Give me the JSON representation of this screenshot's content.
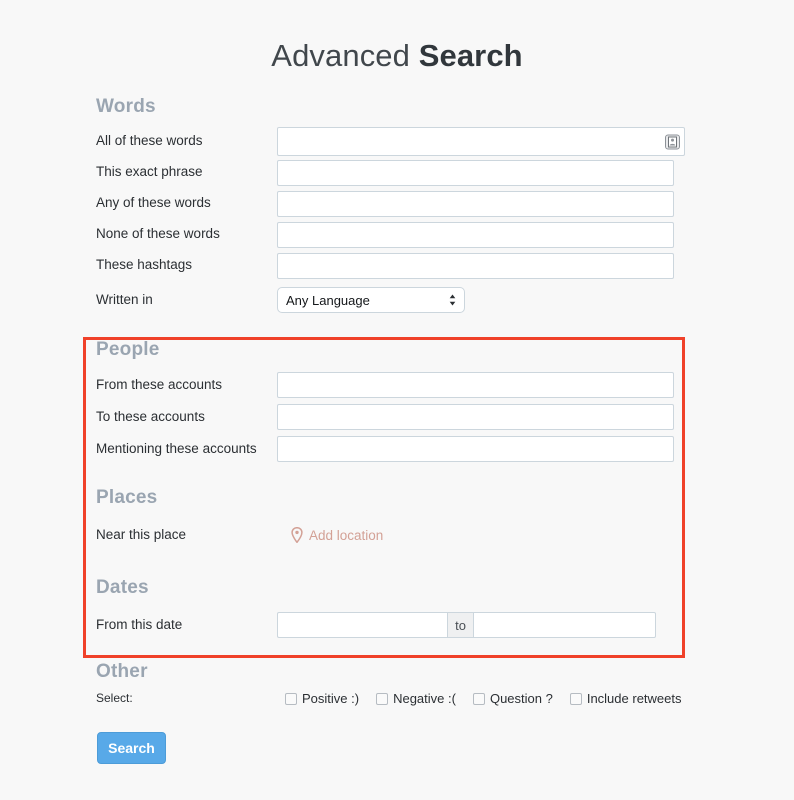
{
  "header": {
    "title_light": "Advanced ",
    "title_bold": "Search"
  },
  "sections": {
    "words": {
      "heading": "Words",
      "fields": [
        {
          "label": "All of these words",
          "value": "",
          "placeholder": "",
          "icon": "contact-card-icon"
        },
        {
          "label": "This exact phrase",
          "value": "",
          "placeholder": ""
        },
        {
          "label": "Any of these words",
          "value": "",
          "placeholder": ""
        },
        {
          "label": "None of these words",
          "value": "",
          "placeholder": ""
        },
        {
          "label": "These hashtags",
          "value": "",
          "placeholder": ""
        }
      ],
      "language": {
        "label": "Written in",
        "selected": "Any Language"
      }
    },
    "people": {
      "heading": "People",
      "fields": [
        {
          "label": "From these accounts",
          "value": "",
          "placeholder": ""
        },
        {
          "label": "To these accounts",
          "value": "",
          "placeholder": ""
        },
        {
          "label": "Mentioning these accounts",
          "value": "",
          "placeholder": ""
        }
      ]
    },
    "places": {
      "heading": "Places",
      "label": "Near this place",
      "link_text": "Add location",
      "link_icon": "map-pin-icon"
    },
    "dates": {
      "heading": "Dates",
      "label": "From this date",
      "from_value": "",
      "from_placeholder": "",
      "separator": "to",
      "to_value": "",
      "to_placeholder": ""
    },
    "other": {
      "heading": "Other",
      "select_label": "Select:",
      "checkboxes": [
        {
          "label": "Positive :)",
          "checked": false
        },
        {
          "label": "Negative :(",
          "checked": false
        },
        {
          "label": "Question ?",
          "checked": false
        },
        {
          "label": "Include retweets",
          "checked": false
        }
      ]
    }
  },
  "submit": {
    "label": "Search"
  },
  "colors": {
    "page_background": "#f8f8f8",
    "section_heading": "#9aa5b1",
    "highlight_border": "#f0412a",
    "link": "#d3a196",
    "button": "#58a9e8",
    "input_border": "#ccd6dd"
  }
}
